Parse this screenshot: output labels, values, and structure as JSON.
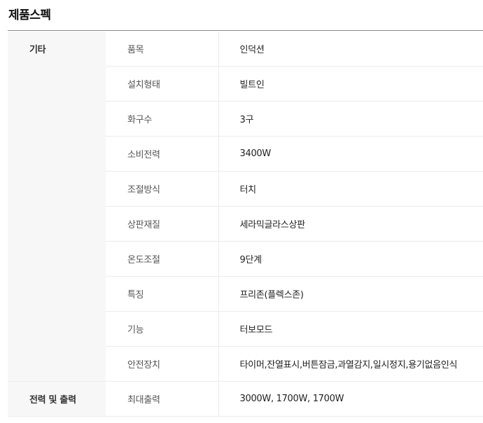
{
  "page": {
    "title": "제품스펙"
  },
  "spec_groups": [
    {
      "group": "기타",
      "rows": [
        {
          "key": "품목",
          "value": "인덕션"
        },
        {
          "key": "설치형태",
          "value": "빌트인"
        },
        {
          "key": "화구수",
          "value": "3구"
        },
        {
          "key": "소비전력",
          "value": "3400W"
        },
        {
          "key": "조절방식",
          "value": "터치"
        },
        {
          "key": "상판재질",
          "value": "세라믹글라스상판"
        },
        {
          "key": "온도조절",
          "value": "9단계"
        },
        {
          "key": "특징",
          "value": "프리존(플렉스존)"
        },
        {
          "key": "기능",
          "value": "터보모드"
        },
        {
          "key": "안전장치",
          "value": "타이머,잔열표시,버튼잠금,과열감지,일시정지,용기없음인식"
        }
      ]
    },
    {
      "group": "전력 및 출력",
      "rows": [
        {
          "key": "최대출력",
          "value": "3000W, 1700W, 1700W"
        }
      ]
    }
  ]
}
